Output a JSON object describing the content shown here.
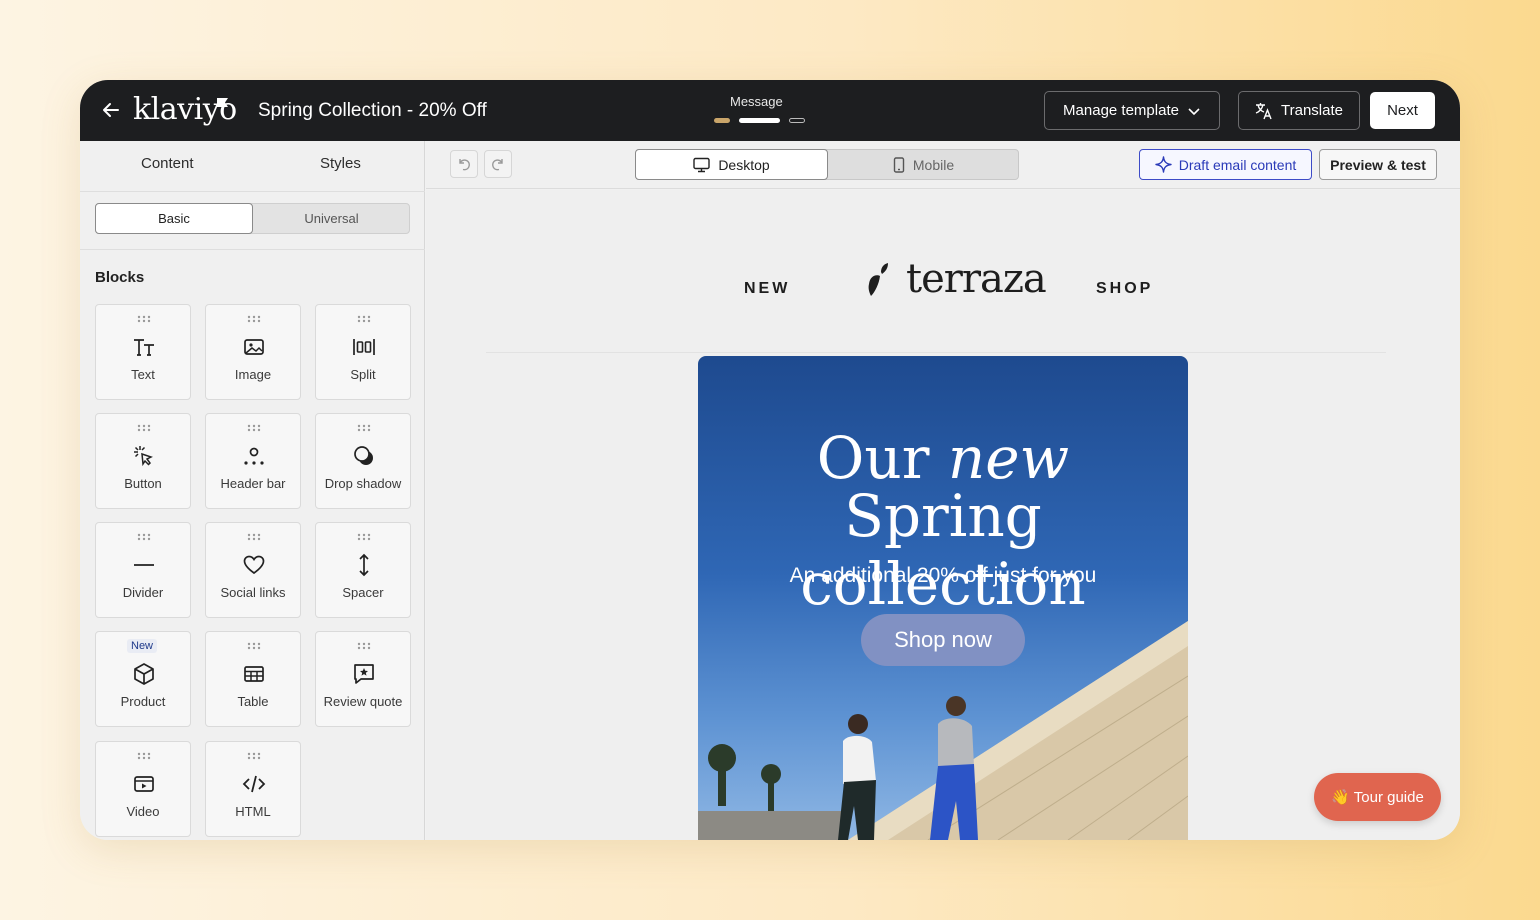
{
  "app": {
    "logo_text": "klaviyo",
    "title": "Spring Collection - 20% Off",
    "step_label": "Message",
    "buttons": {
      "manage_template": "Manage template",
      "translate": "Translate",
      "next": "Next"
    }
  },
  "sidebar": {
    "tabs": [
      "Content",
      "Styles"
    ],
    "segment": {
      "basic": "Basic",
      "universal": "Universal"
    },
    "blocks_title": "Blocks",
    "blocks": [
      {
        "label": "Text",
        "icon": "text-icon"
      },
      {
        "label": "Image",
        "icon": "image-icon"
      },
      {
        "label": "Split",
        "icon": "split-icon"
      },
      {
        "label": "Button",
        "icon": "button-click-icon"
      },
      {
        "label": "Header bar",
        "icon": "header-bar-icon"
      },
      {
        "label": "Drop shadow",
        "icon": "drop-shadow-icon"
      },
      {
        "label": "Divider",
        "icon": "divider-icon"
      },
      {
        "label": "Social links",
        "icon": "heart-icon"
      },
      {
        "label": "Spacer",
        "icon": "spacer-icon"
      },
      {
        "label": "Product",
        "icon": "cube-icon",
        "badge": "New"
      },
      {
        "label": "Table",
        "icon": "table-icon"
      },
      {
        "label": "Review quote",
        "icon": "review-quote-icon"
      },
      {
        "label": "Video",
        "icon": "video-icon"
      },
      {
        "label": "HTML",
        "icon": "code-icon"
      }
    ]
  },
  "toolbar": {
    "desktop": "Desktop",
    "mobile": "Mobile",
    "draft": "Draft email content",
    "preview": "Preview & test"
  },
  "email": {
    "nav_left": "NEW",
    "brand": "terraza",
    "nav_right": "SHOP",
    "hero_word1": "Our",
    "hero_word2": "new",
    "hero_line2": "Spring collection",
    "hero_sub": "An additional 20% off just for you",
    "cta": "Shop now"
  },
  "tour_guide": "👋 Tour guide",
  "colors": {
    "topbar": "#1d1e20",
    "accent_draft": "#3d4bc7",
    "tour": "#e0654f"
  }
}
